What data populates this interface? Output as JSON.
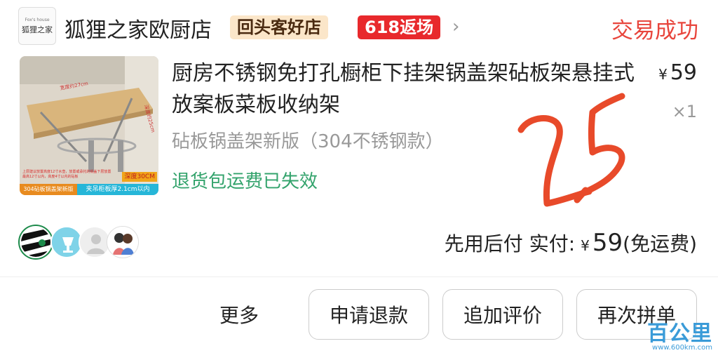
{
  "store": {
    "logo_small": "Fox's house",
    "logo_text": "狐狸之家",
    "name": "狐狸之家欧厨店",
    "badge_repeat": "回头客好店",
    "badge_618": "618返场",
    "chevron": "›"
  },
  "order_status": "交易成功",
  "product": {
    "title": "厨房不锈钢免打孔橱柜下挂架锅盖架砧板架悬挂式放案板菜板收纳架",
    "price_currency": "¥",
    "price": "59",
    "quantity": "×1",
    "sku": "砧板锅盖架新版（304不锈钢款）",
    "return_note": "退货包运费已失效",
    "thumb": {
      "tag_left": "304砧板锅盖架新版",
      "tag_right": "夹吊柜板厚2.1cm以内",
      "tag_depth": "深度30CM",
      "small_text": "上层建议放置高度12寸水壶，放置或承托的锅盖下层放置最高12寸以内，高度4寸以内的砧板",
      "width_label": "宽度约27cm",
      "depth_label": "深度约25cm"
    }
  },
  "handwriting_text": "25",
  "payment": {
    "label": "先用后付 实付:",
    "currency": "¥",
    "amount": "59",
    "note": "(免运费)"
  },
  "actions": {
    "more": "更多",
    "refund": "申请退款",
    "review": "追加评价",
    "reorder": "再次拼单"
  },
  "watermark": {
    "main": "百公里",
    "url": "www.600km.com"
  },
  "colors": {
    "status_red": "#e8453c",
    "badge_618_red": "#e8292c",
    "green_note": "#33a36c",
    "handwriting": "#e84a2a"
  }
}
